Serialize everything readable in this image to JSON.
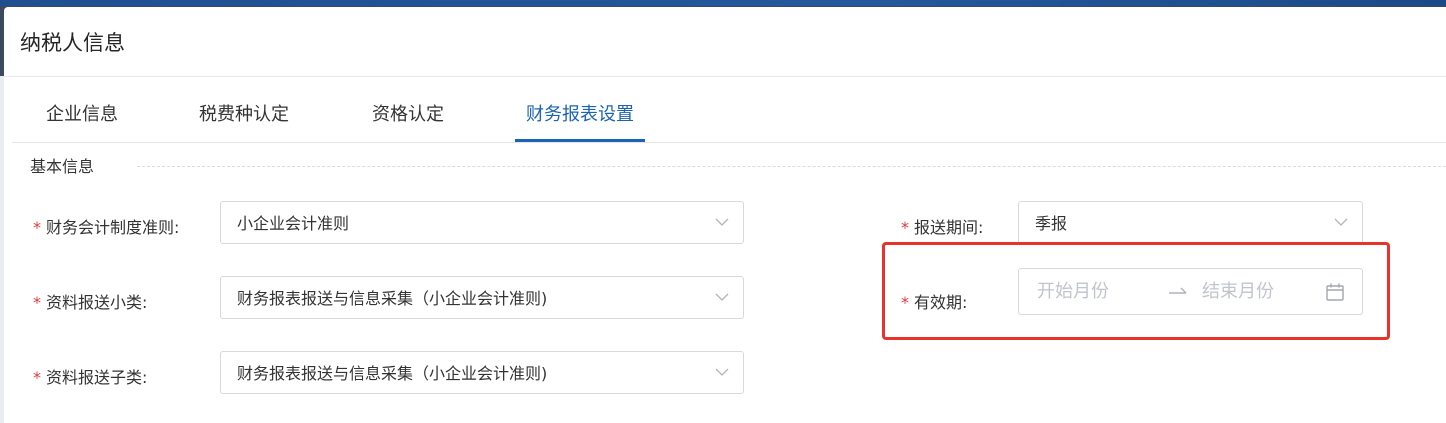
{
  "modal": {
    "title": "纳税人信息"
  },
  "tabs": [
    {
      "label": "企业信息"
    },
    {
      "label": "税费种认定"
    },
    {
      "label": "资格认定"
    },
    {
      "label": "财务报表设置"
    }
  ],
  "section": {
    "title": "基本信息"
  },
  "form": {
    "accounting_standard": {
      "label": "财务会计制度准则:",
      "value": "小企业会计准则"
    },
    "report_period": {
      "label": "报送期间:",
      "value": "季报"
    },
    "data_subclass": {
      "label": "资料报送小类:",
      "value": "财务报表报送与信息采集（小企业会计准则)"
    },
    "validity": {
      "label": "有效期:",
      "start_placeholder": "开始月份",
      "end_placeholder": "结束月份"
    },
    "data_subcategory": {
      "label": "资料报送子类:",
      "value": "财务报表报送与信息采集（小企业会计准则)"
    }
  },
  "required_mark": "*",
  "colors": {
    "accent": "#1b64b4",
    "required": "#e5383b",
    "highlight": "#e8332a"
  },
  "icons": {
    "select_arrow": "chevron-down-icon",
    "range_separator": "arrow-right-icon",
    "date_picker": "calendar-icon"
  }
}
